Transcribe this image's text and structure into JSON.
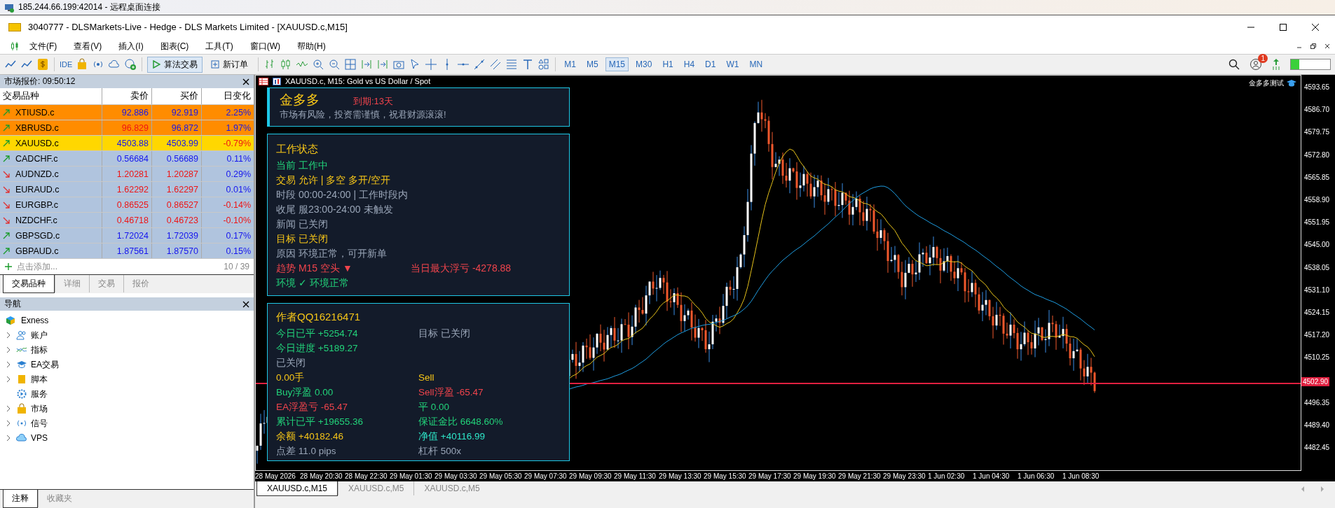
{
  "remote_title": "185.244.66.199:42014 - 远程桌面连接",
  "window": {
    "title": "3040777 - DLSMarkets-Live - Hedge - DLS Markets Limited - [XAUUSD.c,M15]"
  },
  "menu": [
    "文件(F)",
    "查看(V)",
    "插入(I)",
    "图表(C)",
    "工具(T)",
    "窗口(W)",
    "帮助(H)"
  ],
  "toolbar": {
    "ide": "IDE",
    "algo_trading": {
      "label": "算法交易",
      "on": true
    },
    "new_order": "新订单",
    "notification_count": "1",
    "timeframes": [
      {
        "label": "M1",
        "selected": false
      },
      {
        "label": "M5",
        "selected": false
      },
      {
        "label": "M15",
        "selected": true
      },
      {
        "label": "M30",
        "selected": false
      },
      {
        "label": "H1",
        "selected": false
      },
      {
        "label": "H4",
        "selected": false
      },
      {
        "label": "D1",
        "selected": false
      },
      {
        "label": "W1",
        "selected": false
      },
      {
        "label": "MN",
        "selected": false
      }
    ]
  },
  "market_watch": {
    "title": "市场报价:",
    "time": "09:50:12",
    "columns": [
      "交易品种",
      "卖价",
      "买价",
      "日变化"
    ],
    "rows": [
      {
        "symbol": "XTIUSD.c",
        "bid": "92.886",
        "ask": "92.919",
        "change": "2.25%",
        "rising": true,
        "bid_up": true,
        "ask_up": true,
        "change_up": true,
        "color": "#ff8c00"
      },
      {
        "symbol": "XBRUSD.c",
        "bid": "96.829",
        "ask": "96.872",
        "change": "1.97%",
        "rising": true,
        "bid_up": false,
        "ask_up": true,
        "change_up": true,
        "color": "#ff8c00"
      },
      {
        "symbol": "XAUUSD.c",
        "bid": "4503.88",
        "ask": "4503.99",
        "change": "-0.79%",
        "rising": true,
        "bid_up": true,
        "ask_up": true,
        "change_up": false,
        "color": "#ffd700"
      },
      {
        "symbol": "CADCHF.c",
        "bid": "0.56684",
        "ask": "0.56689",
        "change": "0.11%",
        "rising": true,
        "bid_up": true,
        "ask_up": true,
        "change_up": true,
        "color": "#b0c4de"
      },
      {
        "symbol": "AUDNZD.c",
        "bid": "1.20281",
        "ask": "1.20287",
        "change": "0.29%",
        "rising": false,
        "bid_up": false,
        "ask_up": false,
        "change_up": true,
        "color": "#b0c4de"
      },
      {
        "symbol": "EURAUD.c",
        "bid": "1.62292",
        "ask": "1.62297",
        "change": "0.01%",
        "rising": false,
        "bid_up": false,
        "ask_up": false,
        "change_up": true,
        "color": "#b0c4de"
      },
      {
        "symbol": "EURGBP.c",
        "bid": "0.86525",
        "ask": "0.86527",
        "change": "-0.14%",
        "rising": false,
        "bid_up": false,
        "ask_up": false,
        "change_up": false,
        "color": "#b0c4de"
      },
      {
        "symbol": "NZDCHF.c",
        "bid": "0.46718",
        "ask": "0.46723",
        "change": "-0.10%",
        "rising": false,
        "bid_up": false,
        "ask_up": false,
        "change_up": false,
        "color": "#b0c4de"
      },
      {
        "symbol": "GBPSGD.c",
        "bid": "1.72024",
        "ask": "1.72039",
        "change": "0.17%",
        "rising": true,
        "bid_up": true,
        "ask_up": true,
        "change_up": true,
        "color": "#b0c4de"
      },
      {
        "symbol": "GBPAUD.c",
        "bid": "1.87561",
        "ask": "1.87570",
        "change": "0.15%",
        "rising": true,
        "bid_up": true,
        "ask_up": true,
        "change_up": true,
        "color": "#b0c4de"
      }
    ],
    "add_text": "点击添加...",
    "count": "10 / 39",
    "tabs": [
      {
        "label": "交易品种",
        "selected": true
      },
      {
        "label": "详细",
        "selected": false
      },
      {
        "label": "交易",
        "selected": false
      },
      {
        "label": "报价",
        "selected": false
      }
    ]
  },
  "navigator": {
    "title": "导航",
    "root": "Exness",
    "items": [
      {
        "label": "账户",
        "kind": "accounts",
        "expandable": true
      },
      {
        "label": "指标",
        "kind": "indicators",
        "expandable": true
      },
      {
        "label": "EA交易",
        "kind": "experts",
        "expandable": true
      },
      {
        "label": "脚本",
        "kind": "scripts",
        "expandable": true
      },
      {
        "label": "服务",
        "kind": "services",
        "expandable": false
      },
      {
        "label": "市场",
        "kind": "market",
        "expandable": true
      },
      {
        "label": "信号",
        "kind": "signals",
        "expandable": true
      },
      {
        "label": "VPS",
        "kind": "vps",
        "expandable": true
      }
    ]
  },
  "bottom_tabs": [
    {
      "label": "注释",
      "selected": true
    },
    {
      "label": "收藏夹",
      "selected": false
    }
  ],
  "chart": {
    "title": "XAUUSD.c, M15:  Gold vs US Dollar / Spot",
    "corner_label": "金多多测试",
    "current_price": "4502.90",
    "price_ticks": [
      "4593.65",
      "4586.70",
      "4579.75",
      "4572.80",
      "4565.85",
      "4558.90",
      "4551.95",
      "4545.00",
      "4538.05",
      "4531.10",
      "4524.15",
      "4517.20",
      "4510.25",
      "4496.35",
      "4489.40",
      "4482.45"
    ],
    "time_labels": [
      "28 May 2026",
      "28 May 20:30",
      "28 May 22:30",
      "29 May 01:30",
      "29 May 03:30",
      "29 May 05:30",
      "29 May 07:30",
      "29 May 09:30",
      "29 May 11:30",
      "29 May 13:30",
      "29 May 15:30",
      "29 May 17:30",
      "29 May 19:30",
      "29 May 21:30",
      "29 May 23:30",
      "1 Jun 02:30",
      "1 Jun 04:30",
      "1 Jun 06:30",
      "1 Jun 08:30"
    ]
  },
  "ea_panel": {
    "name": "金多多",
    "expiry": "到期:13天",
    "slogan": "市场有风险，投资需谨慎，祝君财源滚滚!",
    "status_title": "工作状态",
    "status_lines": [
      {
        "text": "当前  工作中",
        "color": "#22d37a"
      },
      {
        "text": "交易  允许  |  多空  多开/空开",
        "color": "#f5c518"
      },
      {
        "text": "时段  00:00-24:00  |  工作时段内",
        "color": "#9aa6b8"
      },
      {
        "text": "收尾  服23:00-24:00 未触发",
        "color": "#9aa6b8"
      },
      {
        "text": "新闻  已关闭",
        "color": "#9aa6b8"
      },
      {
        "text": "目标  已关闭",
        "color": "#f5c518"
      },
      {
        "text": "原因  环境正常，可开新单",
        "color": "#9aa6b8"
      },
      {
        "text": "趋势  M15 空头 ▼",
        "color": "#f0444c",
        "aside": {
          "text": "当日最大浮亏 -4278.88",
          "color": "#f0444c"
        }
      },
      {
        "text": "环境  ✓ 环境正常",
        "color": "#22d37a"
      }
    ],
    "author": "作者QQ16216471",
    "stats": [
      {
        "left": {
          "text": "今日已平  +5254.74",
          "color": "#22d37a"
        },
        "right": {
          "text": "目标  已关闭",
          "color": "#9aa6b8"
        }
      },
      {
        "left": {
          "text": "今日进度  +5189.27",
          "color": "#22d37a"
        }
      },
      {
        "left": {
          "text": "已关闭",
          "color": "#9aa6b8"
        }
      },
      {
        "left": {
          "text": "0.00手",
          "color": "#f5c518"
        },
        "right": {
          "text": "Sell",
          "color": "#f5c518"
        }
      },
      {
        "left": {
          "text": "Buy浮盈  0.00",
          "color": "#22d37a"
        },
        "right": {
          "text": "Sell浮盈  -65.47",
          "color": "#f0444c"
        }
      },
      {
        "left": {
          "text": "EA浮盈亏  -65.47",
          "color": "#f0444c"
        },
        "right": {
          "text": "平  0.00",
          "color": "#22d37a"
        }
      },
      {
        "left": {
          "text": "累计已平  +19655.36",
          "color": "#22d37a"
        },
        "right": {
          "text": "保证金比  6648.60%",
          "color": "#22d37a"
        }
      },
      {
        "left": {
          "text": "余额  +40182.46",
          "color": "#f5c518"
        },
        "right": {
          "text": "净值  +40116.99",
          "color": "#2ee6c8"
        }
      },
      {
        "left": {
          "text": "点差  11.0 pips",
          "color": "#9aa6b8"
        },
        "right": {
          "text": "杠杆  500x",
          "color": "#9aa6b8"
        }
      }
    ]
  },
  "chart_tabs": [
    {
      "label": "XAUUSD.c,M15",
      "selected": true
    },
    {
      "label": "XAUUSD.c,M5",
      "selected": false
    },
    {
      "label": "XAUUSD.c,M5",
      "selected": false
    }
  ]
}
